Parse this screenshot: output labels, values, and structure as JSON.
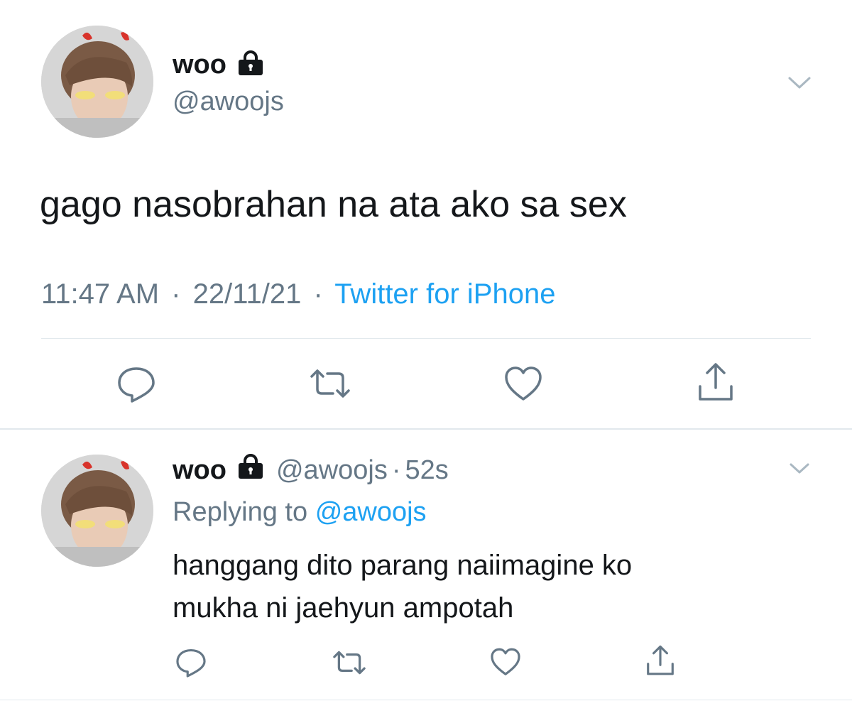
{
  "main_tweet": {
    "display_name": "woo",
    "handle": "@awoojs",
    "text": "gago nasobrahan na ata ako sa sex",
    "time": "11:47 AM",
    "separator": "·",
    "date": "22/11/21",
    "source": "Twitter for iPhone"
  },
  "reply_tweet": {
    "display_name": "woo",
    "handle": "@awoojs",
    "separator": "·",
    "age": "52s",
    "replying_to_label": "Replying to",
    "replying_to_handle": "@awoojs",
    "text_line1": "hanggang dito parang naiimagine ko",
    "text_line2": "mukha ni jaehyun ampotah"
  },
  "icons": {
    "lock": "lock-icon",
    "chevron": "chevron-down-icon",
    "reply": "reply-icon",
    "retweet": "retweet-icon",
    "like": "heart-icon",
    "share": "share-icon"
  },
  "colors": {
    "text": "#14171a",
    "muted": "#657786",
    "link": "#1da1f2",
    "divider": "#e1e8ed"
  }
}
